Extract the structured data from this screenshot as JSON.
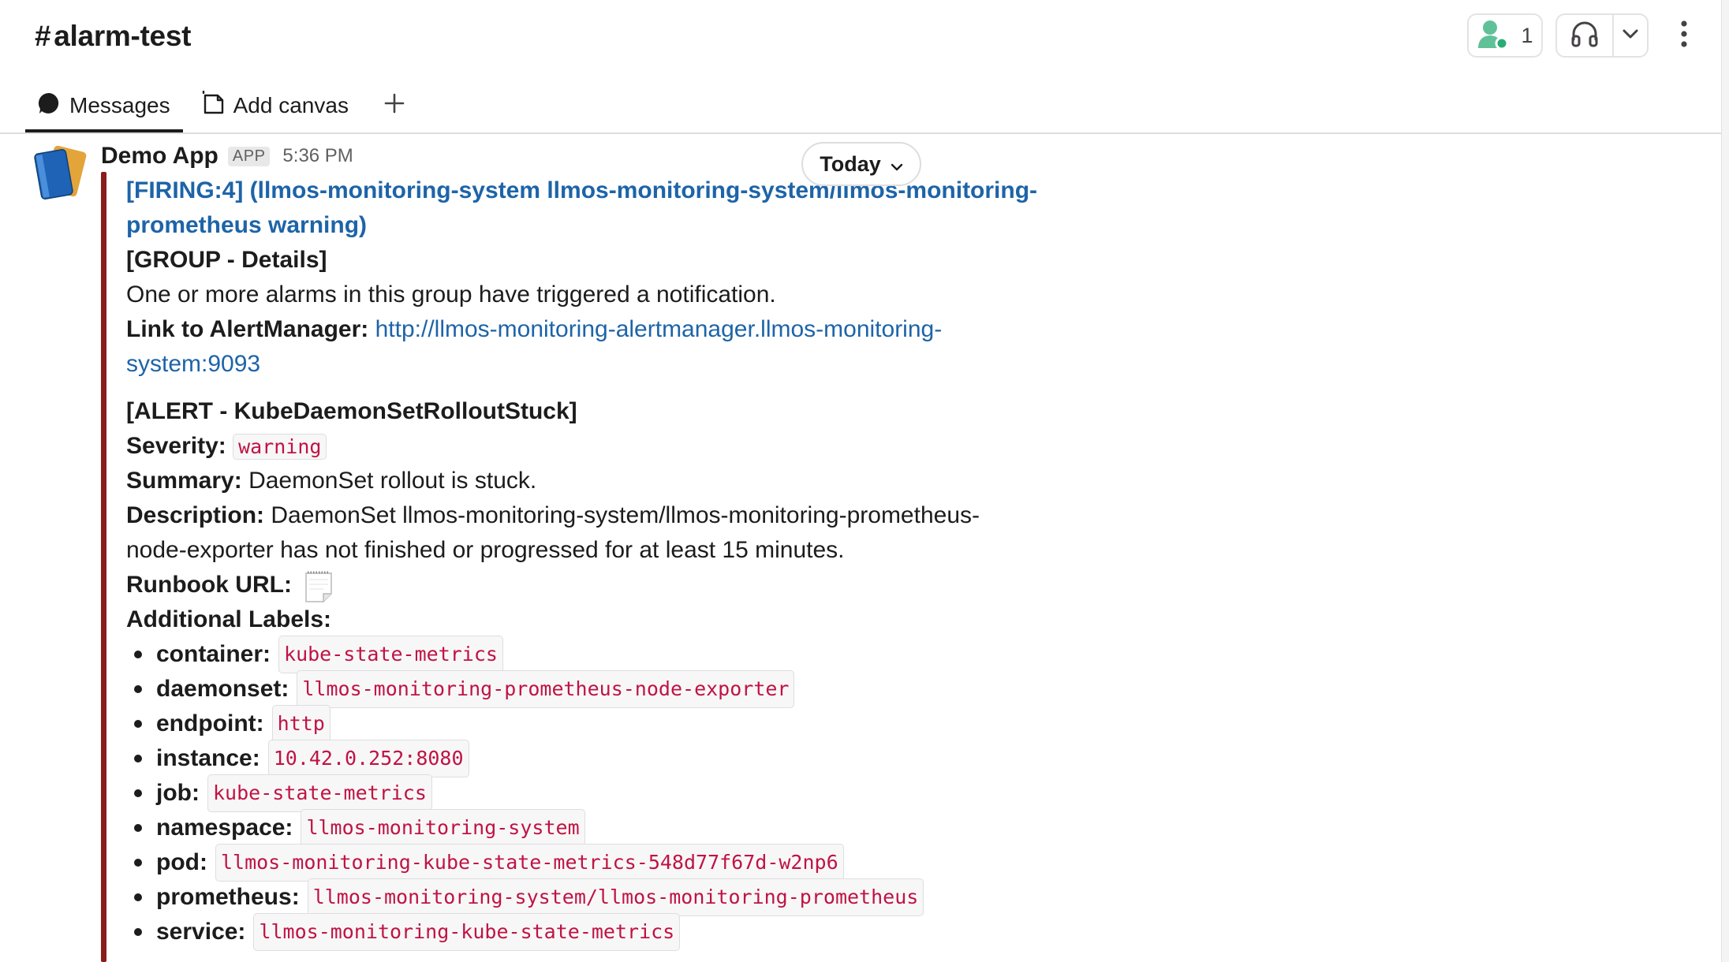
{
  "header": {
    "channel_name": "alarm-test",
    "hash": "#",
    "member_count": "1"
  },
  "tabs": [
    {
      "label": "Messages",
      "active": true
    },
    {
      "label": "Add canvas",
      "active": false
    }
  ],
  "date_divider": "Today",
  "message": {
    "sender": "Demo App",
    "badge": "APP",
    "time": "5:36 PM",
    "attachment_color": "#8b1c1c",
    "title_line1": "[FIRING:4]  (llmos-monitoring-system llmos-monitoring-system/llmos-monitoring-",
    "title_line2": "prometheus warning)",
    "group_heading": "[GROUP - Details]",
    "group_text": "One or more alarms in this group have triggered a notification.",
    "link_label": "Link to AlertManager:",
    "link_url_line1": "http://llmos-monitoring-alertmanager.llmos-monitoring-",
    "link_url_line2": "system:9093",
    "alert_heading": "[ALERT - KubeDaemonSetRolloutStuck]",
    "severity_label": "Severity:",
    "severity_value": "warning",
    "summary_label": "Summary:",
    "summary_value": "DaemonSet rollout is stuck.",
    "description_label": "Description:",
    "description_line1": "DaemonSet llmos-monitoring-system/llmos-monitoring-prometheus-",
    "description_line2": "node-exporter has not finished or progressed for at least 15 minutes.",
    "runbook_label": "Runbook URL:",
    "runbook_icon": "notepad-icon",
    "labels_heading": "Additional Labels:",
    "labels": [
      {
        "key": "container:",
        "value": "kube-state-metrics"
      },
      {
        "key": "daemonset:",
        "value": "llmos-monitoring-prometheus-node-exporter"
      },
      {
        "key": "endpoint:",
        "value": "http"
      },
      {
        "key": "instance:",
        "value": "10.42.0.252:8080"
      },
      {
        "key": "job:",
        "value": "kube-state-metrics"
      },
      {
        "key": "namespace:",
        "value": "llmos-monitoring-system"
      },
      {
        "key": "pod:",
        "value": "llmos-monitoring-kube-state-metrics-548d77f67d-w2np6"
      },
      {
        "key": "prometheus:",
        "value": "llmos-monitoring-system/llmos-monitoring-prometheus"
      },
      {
        "key": "service:",
        "value": "llmos-monitoring-kube-state-metrics"
      }
    ]
  },
  "colors": {
    "link": "#1d64a8",
    "code_text": "#c01343",
    "presence_green": "#2bac76"
  }
}
